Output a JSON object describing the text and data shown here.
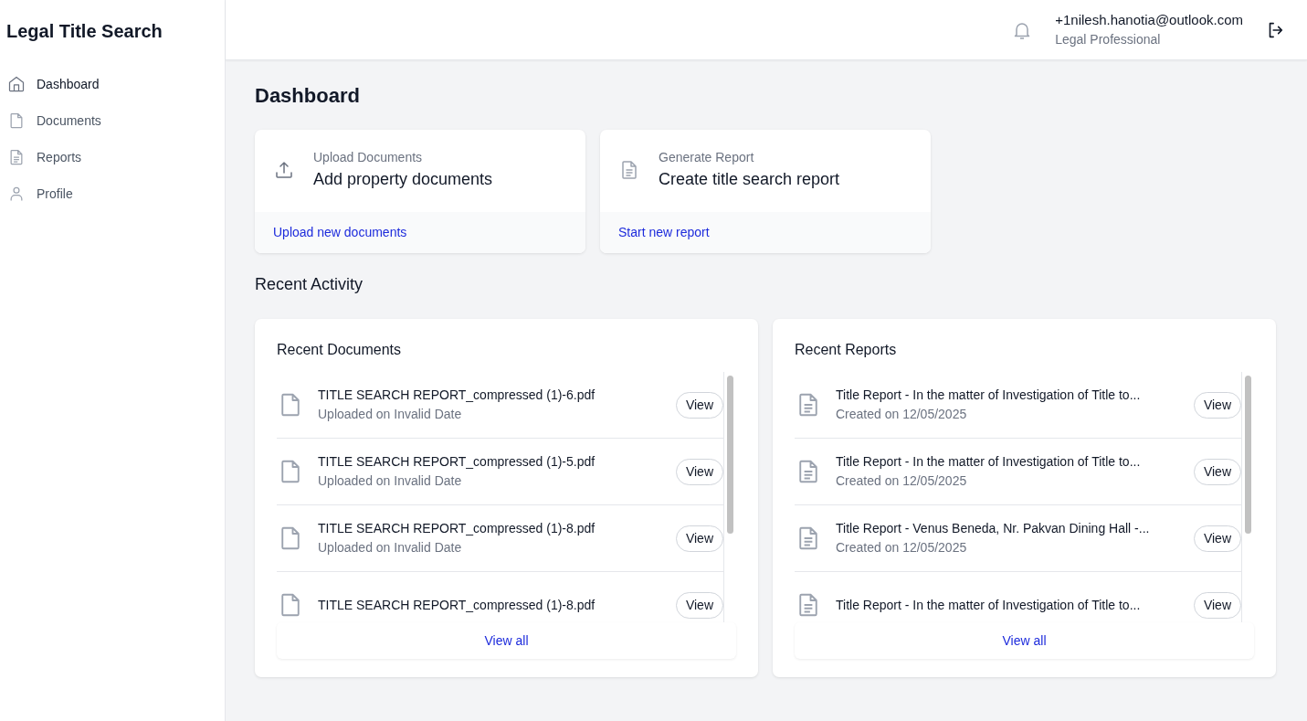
{
  "app_title": "Legal Title Search",
  "sidebar": {
    "items": [
      {
        "label": "Dashboard",
        "selected": true
      },
      {
        "label": "Documents",
        "selected": false
      },
      {
        "label": "Reports",
        "selected": false
      },
      {
        "label": "Profile",
        "selected": false
      }
    ]
  },
  "header": {
    "user_email": "+1nilesh.hanotia@outlook.com",
    "user_role": "Legal Professional"
  },
  "page_title": "Dashboard",
  "quick_actions": [
    {
      "label": "Upload Documents",
      "title": "Add property documents",
      "link": "Upload new documents"
    },
    {
      "label": "Generate Report",
      "title": "Create title search report",
      "link": "Start new report"
    }
  ],
  "recent_activity": {
    "title": "Recent Activity",
    "panels": [
      {
        "title": "Recent Documents",
        "items": [
          {
            "name": "TITLE SEARCH REPORT_compressed (1)-6.pdf",
            "meta": "Uploaded on Invalid Date",
            "action": "View"
          },
          {
            "name": "TITLE SEARCH REPORT_compressed (1)-5.pdf",
            "meta": "Uploaded on Invalid Date",
            "action": "View"
          },
          {
            "name": "TITLE SEARCH REPORT_compressed (1)-8.pdf",
            "meta": "Uploaded on Invalid Date",
            "action": "View"
          },
          {
            "name": "TITLE SEARCH REPORT_compressed (1)-8.pdf",
            "action": "View"
          }
        ],
        "view_all": "View all"
      },
      {
        "title": "Recent Reports",
        "items": [
          {
            "name": "Title Report - In the matter of Investigation of Title to...",
            "meta": "Created on 12/05/2025",
            "action": "View"
          },
          {
            "name": "Title Report - In the matter of Investigation of Title to...",
            "meta": "Created on 12/05/2025",
            "action": "View"
          },
          {
            "name": "Title Report - Venus Beneda, Nr. Pakvan Dining Hall -...",
            "meta": "Created on 12/05/2025",
            "action": "View"
          },
          {
            "name": "Title Report - In the matter of Investigation of Title to...",
            "action": "View"
          }
        ],
        "view_all": "View all"
      }
    ]
  }
}
